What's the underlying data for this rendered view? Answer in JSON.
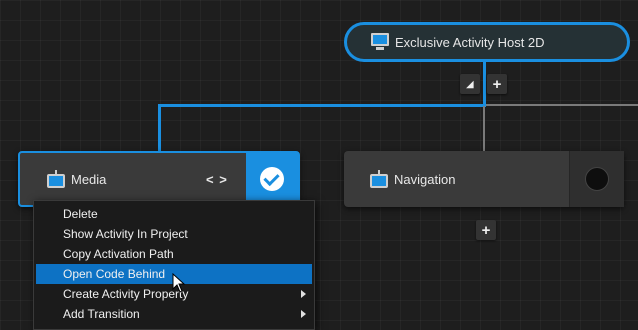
{
  "host_node": {
    "label": "Exclusive Activity Host 2D",
    "icon": "monitor-icon"
  },
  "host_controls": {
    "collapse_glyph": "◢",
    "add_glyph": "+"
  },
  "nodes": [
    {
      "label": "Media",
      "icon": "tv-icon",
      "code_glyph": "< >",
      "state": "selected"
    },
    {
      "label": "Navigation",
      "icon": "tv-icon",
      "state": "inactive"
    }
  ],
  "nav_add_glyph": "+",
  "context_menu": {
    "items": [
      {
        "label": "Delete",
        "submenu": false
      },
      {
        "label": "Show Activity In Project",
        "submenu": false
      },
      {
        "label": "Copy Activation Path",
        "submenu": false
      },
      {
        "label": "Open Code Behind",
        "submenu": false,
        "highlighted": true
      },
      {
        "label": "Create Activity Property",
        "submenu": true
      },
      {
        "label": "Add Transition",
        "submenu": true
      }
    ]
  },
  "colors": {
    "accent": "#1a8fe0",
    "menu_highlight": "#0d72c4",
    "background": "#1e1e1e"
  }
}
